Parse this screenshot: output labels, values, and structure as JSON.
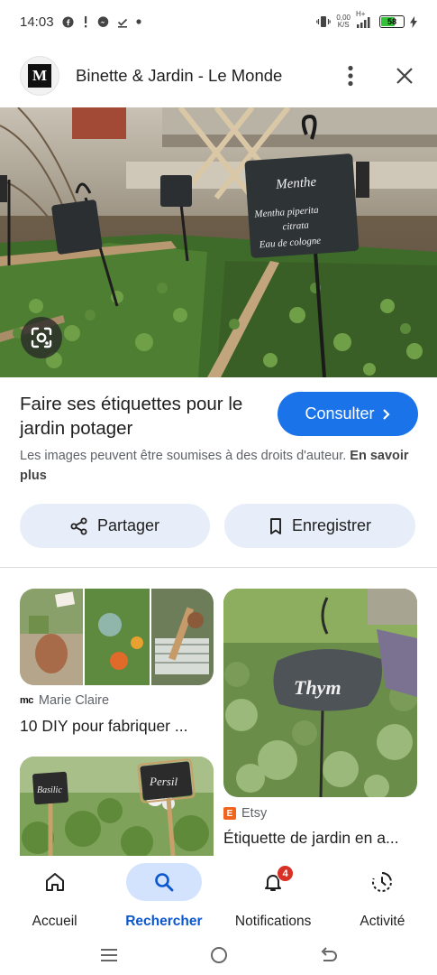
{
  "status_bar": {
    "time": "14:03",
    "net_speed_value": "0,00",
    "net_speed_unit": "K/S",
    "network_type": "H+",
    "battery": "58",
    "battery_level": 0.58
  },
  "header": {
    "logo_text": "M",
    "title": "Binette & Jardin - Le Monde"
  },
  "hero": {
    "sign_main_line1": "Menthe",
    "sign_main_line2": "Mentha piperita",
    "sign_main_line3": "citrata",
    "sign_main_line4": "Eau de cologne"
  },
  "result": {
    "title": "Faire ses étiquettes pour le jardin potager",
    "consult_label": "Consulter",
    "copyright_text": "Les images peuvent être soumises à des droits d'auteur.",
    "learn_more": "En savoir plus"
  },
  "actions": {
    "share_label": "Partager",
    "save_label": "Enregistrer"
  },
  "related": [
    {
      "source_logo": "mc",
      "source": "Marie Claire",
      "title": "10 DIY pour fabriquer ..."
    },
    {
      "source_logo": "E",
      "source": "Etsy",
      "title": "Étiquette de jardin en a...",
      "sign_text": "Thym"
    },
    {
      "sign_left": "Basilic",
      "sign_right": "Persil"
    }
  ],
  "bottom_nav": {
    "items": [
      {
        "label": "Accueil",
        "icon": "home-icon",
        "active": false
      },
      {
        "label": "Rechercher",
        "icon": "search-icon",
        "active": true
      },
      {
        "label": "Notifications",
        "icon": "bell-icon",
        "active": false,
        "badge": "4"
      },
      {
        "label": "Activité",
        "icon": "history-icon",
        "active": false
      }
    ]
  },
  "colors": {
    "accent": "#1a73e8",
    "active_nav": "#0b57d0",
    "pill_bg": "#e8eef9",
    "badge": "#d93025"
  }
}
